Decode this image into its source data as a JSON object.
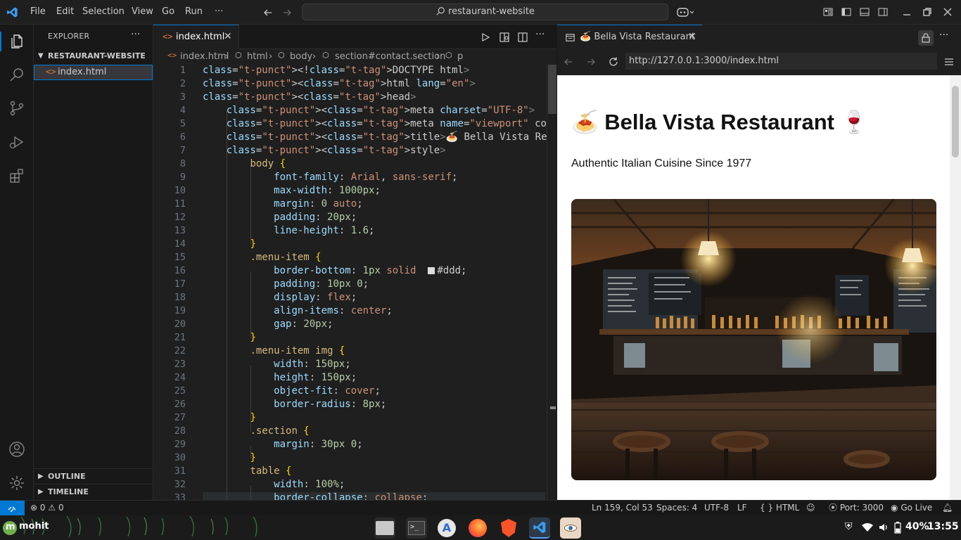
{
  "titlebar": {
    "menus": [
      "File",
      "Edit",
      "Selection",
      "View",
      "Go",
      "Run",
      "···"
    ],
    "search": "restaurant-website"
  },
  "sidebar": {
    "title": "EXPLORER",
    "folder": "RESTAURANT-WEBSITE",
    "files": [
      {
        "name": "index.html"
      }
    ],
    "outline": "OUTLINE",
    "timeline": "TIMELINE"
  },
  "editor": {
    "tab": "index.html",
    "breadcrumb": [
      "index.html",
      "html",
      "body",
      "section#contact.section",
      "p"
    ],
    "line_numbers": [
      "1",
      "2",
      "3",
      "4",
      "5",
      "6",
      "7",
      "8",
      "9",
      "10",
      "11",
      "12",
      "13",
      "14",
      "15",
      "16",
      "17",
      "18",
      "19",
      "20",
      "21",
      "22",
      "23",
      "24",
      "25",
      "26",
      "27",
      "28",
      "29",
      "30",
      "31",
      "32",
      "33"
    ],
    "lines": [
      "<!DOCTYPE html>",
      "<html lang=\"en\">",
      "<head>",
      "    <meta charset=\"UTF-8\">",
      "    <meta name=\"viewport\" content=\"width=device-width, initi",
      "    <title>🍝 Bella Vista Restaurant</title>",
      "    <style>",
      "        body {",
      "            font-family: Arial, sans-serif;",
      "            max-width: 1000px;",
      "            margin: 0 auto;",
      "            padding: 20px;",
      "            line-height: 1.6;",
      "        }",
      "        .menu-item {",
      "            border-bottom: 1px solid  #ddd;",
      "            padding: 10px 0;",
      "            display: flex;",
      "            align-items: center;",
      "            gap: 20px;",
      "        }",
      "        .menu-item img {",
      "            width: 150px;",
      "            height: 150px;",
      "            object-fit: cover;",
      "            border-radius: 8px;",
      "        }",
      "        .section {",
      "            margin: 30px 0;",
      "        }",
      "        table {",
      "            width: 100%;",
      "            border-collapse: collapse;"
    ]
  },
  "preview": {
    "tab": "🍝 Bella Vista Restaurant",
    "url": "http://127.0.0.1:3000/index.html",
    "heading": "🍝 Bella Vista Restaurant 🍷",
    "subtitle": "Authentic Italian Cuisine Since 1977"
  },
  "statusbar": {
    "problems": "0",
    "warnings": "0",
    "position": "Ln 159, Col 53",
    "spaces": "Spaces: 4",
    "encoding": "UTF-8",
    "eol": "LF",
    "language": "HTML",
    "port": "Port: 3000",
    "golive": "Go Live"
  },
  "taskbar": {
    "user": "mohit",
    "battery": "40%",
    "time": "13:55"
  },
  "colors": {
    "accent": "#0078d4",
    "background": "#1f1f1f"
  }
}
